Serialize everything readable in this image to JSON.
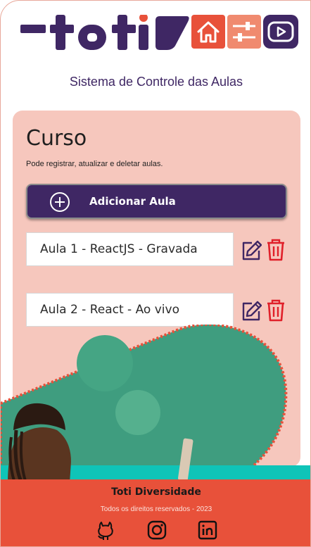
{
  "header": {
    "logo_text": "-toti",
    "nav": [
      {
        "name": "home",
        "icon": "home-icon",
        "color": "#e8513a"
      },
      {
        "name": "settings",
        "icon": "sliders-icon",
        "color": "#f08a6f"
      },
      {
        "name": "play",
        "icon": "play-icon",
        "color": "#3f2764"
      }
    ]
  },
  "system_title": "Sistema de Controle das Aulas",
  "course": {
    "title": "Curso",
    "description": "Pode registrar, atualizar e deletar aulas.",
    "add_button_label": "Adicionar Aula",
    "lessons": [
      {
        "label": "Aula 1 - ReactJS - Gravada"
      },
      {
        "label": "Aula 2 - React - Ao vivo"
      }
    ]
  },
  "footer": {
    "title": "Toti Diversidade",
    "rights": "Todos os direitos reservados - 2023",
    "social": [
      "github-icon",
      "instagram-icon",
      "linkedin-icon"
    ]
  },
  "colors": {
    "primary": "#3f2764",
    "accent": "#e8513a",
    "card": "#f6c7bd",
    "delete": "#e0202a",
    "illustration": "#3f9d7f"
  }
}
